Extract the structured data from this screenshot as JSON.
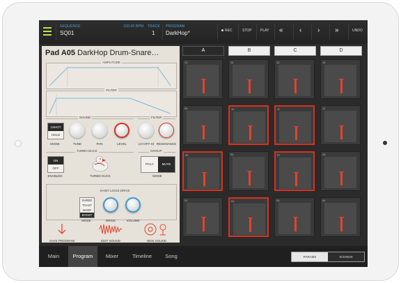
{
  "topbar": {
    "sequence_label": "SEQUENCE",
    "sequence_value": "SQ01",
    "bpm": "100.00 BPM",
    "track_label": "TRACK",
    "track_value": "1",
    "program_label": "PROGRAM",
    "program_value": "DarkHop*",
    "rec": "REC",
    "stop": "STOP",
    "play": "PLAY",
    "undo": "UNDO"
  },
  "program": {
    "title_bold": "Pad A05",
    "title_rest": " DarkHop Drum-Snare…",
    "amplitude_label": "AMPLITUDE",
    "filter_env_label": "FILTER",
    "sound_label": "SOUND",
    "filter_label": "FILTER",
    "mode_options": [
      "1SHOT",
      "HOLD"
    ],
    "mode_label": "MODE",
    "tune_label": "TUNE",
    "pan_label": "PAN",
    "level_label": "LEVEL",
    "lo_off_hi_label": "LO-OFF-HI",
    "resonance_label": "RESONANCE",
    "turbo_duck_label": "TURBO DUCK",
    "group_label": "GROUP",
    "enabled_options": [
      "ON",
      "OFF"
    ],
    "enabled_label": "ENABLED",
    "turbo_duck_knob_label": "TURBO DUCK",
    "group_options": [
      "POLY",
      "MUTE"
    ],
    "group_mode_label": "MODE",
    "drive_section_label": "SAINT LOUIS DRIVE",
    "drive_modes": [
      "SHRED",
      "TOAST",
      "WARP",
      "BOOST"
    ],
    "drive_mode_label": "MODE",
    "drive_label": "DRIVE",
    "volume_label": "VOLUME",
    "save_program": "SAVE PROGRAM",
    "edit_sound": "EDIT SOUND",
    "new_sound": "NEW SOUND"
  },
  "bank_tabs": [
    "A",
    "B",
    "C",
    "D"
  ],
  "pads": [
    {
      "num": "13",
      "level": 0.6,
      "lit": false
    },
    {
      "num": "14",
      "level": 0.55,
      "lit": false
    },
    {
      "num": "15",
      "level": 0.6,
      "lit": false
    },
    {
      "num": "16",
      "level": 0.6,
      "lit": false
    },
    {
      "num": "09",
      "level": 0.55,
      "lit": false
    },
    {
      "num": "10",
      "level": 0.6,
      "lit": true
    },
    {
      "num": "11",
      "level": 0.55,
      "lit": true
    },
    {
      "num": "12",
      "level": 0.55,
      "lit": false
    },
    {
      "num": "05",
      "level": 0.55,
      "lit": true
    },
    {
      "num": "06",
      "level": 0.6,
      "lit": false
    },
    {
      "num": "07",
      "level": 0.55,
      "lit": true
    },
    {
      "num": "08",
      "level": 0.55,
      "lit": false
    },
    {
      "num": "01",
      "level": 0.6,
      "lit": false
    },
    {
      "num": "02",
      "level": 0.6,
      "lit": true
    },
    {
      "num": "03",
      "level": 0.6,
      "lit": false
    },
    {
      "num": "04",
      "level": 0.6,
      "lit": false
    }
  ],
  "bottom_nav": [
    "Main",
    "Program",
    "Mixer",
    "Timeline",
    "Song"
  ],
  "active_nav": "Program",
  "view_toggle": [
    "PARAMS",
    "SOUNDS"
  ],
  "colors": {
    "accent_red": "#d8321f",
    "accent_blue": "#3a9ad6",
    "accent_green": "#bfe34a"
  }
}
